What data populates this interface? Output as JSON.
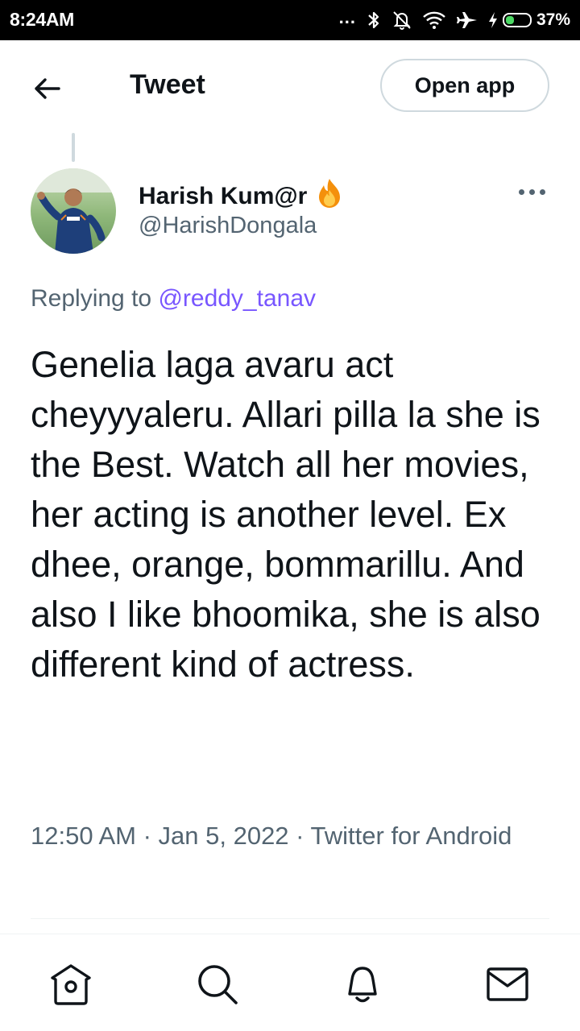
{
  "status_bar": {
    "time": "8:24AM",
    "dots": "...",
    "battery_percent_label": "37%",
    "battery_level": 0.37,
    "icons": [
      "bluetooth-icon",
      "mute-bell-icon",
      "wifi-icon",
      "airplane-icon",
      "charging-icon",
      "battery-icon"
    ]
  },
  "header": {
    "title": "Tweet",
    "open_app_label": "Open app",
    "back_icon": "arrow-left-icon"
  },
  "tweet": {
    "author_name": "Harish Kum@r",
    "author_emoji": "🔥",
    "author_handle": "@HarishDongala",
    "replying_prefix": "Replying to ",
    "replying_to": "@reddy_tanav",
    "text": "Genelia laga avaru act cheyyyaleru. Allari pilla la she is the Best. Watch all her movies, her acting is another level. Ex dhee, orange, bommarillu. And also I like bhoomika, she is also different kind of actress.",
    "meta": "12:50 AM · Jan 5, 2022 · Twitter for Android"
  },
  "colors": {
    "text_primary": "#0f1419",
    "text_secondary": "#536471",
    "link": "#7856ff",
    "border": "#cfd9de"
  },
  "bottom_nav": [
    "home-icon",
    "search-icon",
    "notifications-bell-icon",
    "messages-mail-icon"
  ]
}
